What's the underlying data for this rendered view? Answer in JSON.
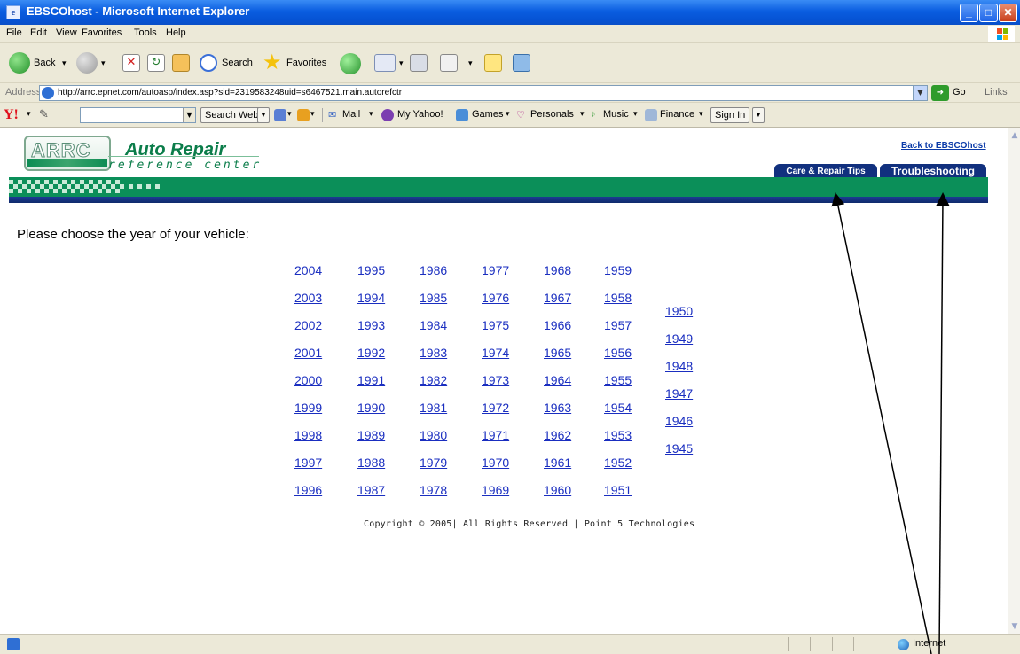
{
  "window": {
    "title": "EBSCOhost - Microsoft Internet Explorer"
  },
  "menu": [
    "File",
    "Edit",
    "View",
    "Favorites",
    "Tools",
    "Help"
  ],
  "toolbar": {
    "back": "Back",
    "search": "Search",
    "favorites": "Favorites"
  },
  "address": {
    "label": "Address",
    "url": "http://arrc.epnet.com/autoasp/index.asp?sid=2319583248uid=s6467521.main.autorefctr",
    "go": "Go",
    "links": "Links"
  },
  "yahoo": {
    "logo": "Y!",
    "search_web": "Search Web",
    "items": [
      "Mail",
      "My Yahoo!",
      "Games",
      "Personals",
      "Music",
      "Finance"
    ],
    "sign_in": "Sign In"
  },
  "site": {
    "logo_text": "ARRC",
    "title": "Auto Repair",
    "subtitle": "reference center",
    "back_link": "Back to EBSCOhost",
    "tabs": [
      "Care & Repair Tips",
      "Troubleshooting"
    ],
    "prompt": "Please choose the year of your vehicle:",
    "copyright": "Copyright © 2005| All Rights Reserved | Point 5 Technologies"
  },
  "years": {
    "col1": [
      "2004",
      "2003",
      "2002",
      "2001",
      "2000",
      "1999",
      "1998",
      "1997",
      "1996"
    ],
    "col2": [
      "1995",
      "1994",
      "1993",
      "1992",
      "1991",
      "1990",
      "1989",
      "1988",
      "1987"
    ],
    "col3": [
      "1986",
      "1985",
      "1984",
      "1983",
      "1982",
      "1981",
      "1980",
      "1979",
      "1978"
    ],
    "col4": [
      "1977",
      "1976",
      "1975",
      "1974",
      "1973",
      "1972",
      "1971",
      "1970",
      "1969"
    ],
    "col5": [
      "1968",
      "1967",
      "1966",
      "1965",
      "1964",
      "1963",
      "1962",
      "1961",
      "1960"
    ],
    "col6": [
      "1959",
      "1958",
      "1957",
      "1956",
      "1955",
      "1954",
      "1953",
      "1952",
      "1951"
    ],
    "col7": [
      "1950",
      "1949",
      "1948",
      "1947",
      "1946",
      "1945"
    ]
  },
  "status": {
    "zone": "Internet"
  },
  "colors": {
    "title_bar": "#0a5de0",
    "site_green": "#0b8f59",
    "site_navy": "#11307e",
    "link_blue": "#1a2ec0"
  }
}
